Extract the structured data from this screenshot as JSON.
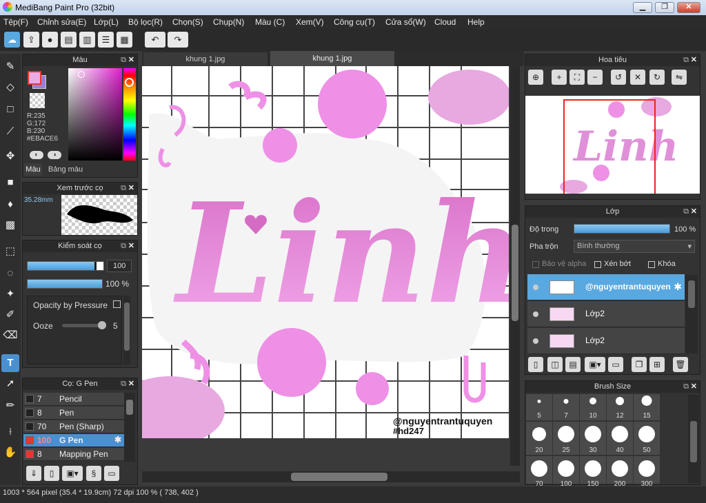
{
  "window": {
    "title": "MediBang Paint Pro (32bit)",
    "minimize": "▁",
    "maximize": "❐",
    "close": "✕"
  },
  "menu": [
    "Tệp(F)",
    "Chỉnh sửa(E)",
    "Lớp(L)",
    "Bộ lọc(R)",
    "Chọn(S)",
    "Chụp(N)",
    "Màu (C)",
    "Xem(V)",
    "Công cụ(T)",
    "Cửa sổ(W)",
    "Cloud",
    "Help"
  ],
  "tabs": [
    "khung 1.jpg",
    "khung 1.jpg"
  ],
  "color_panel": {
    "title": "Màu",
    "r": "R:235",
    "g": "G:172",
    "b": "B:230",
    "hex": "#EBACE6",
    "tab1": "Màu",
    "tab2": "Bảng màu",
    "main_color": "#EBACE6",
    "sub_color": "#9b7fd6"
  },
  "brush_preview": {
    "title": "Xem trước cọ",
    "size": "35.28mm"
  },
  "brush_control": {
    "title": "Kiểm soát cọ",
    "size_value": "100",
    "opacity_value": "100 %",
    "opacity_pressure": "Opacity by Pressure",
    "ooze_label": "Ooze",
    "ooze_value": "5"
  },
  "brush_list": {
    "title": "Cọ: G Pen",
    "items": [
      {
        "size": "7",
        "name": "Pencil",
        "color": "#222"
      },
      {
        "size": "8",
        "name": "Pen",
        "color": "#222"
      },
      {
        "size": "70",
        "name": "Pen (Sharp)",
        "color": "#222"
      },
      {
        "size": "100",
        "name": "G Pen",
        "color": "#e33"
      },
      {
        "size": "8",
        "name": "Mapping Pen",
        "color": "#e33"
      }
    ]
  },
  "navigator": {
    "title": "Hoa tiêu"
  },
  "layers": {
    "title": "Lớp",
    "opacity_label": "Độ trong",
    "opacity_value": "100 %",
    "opacity_level": 1.0,
    "blend_label": "Pha trộn",
    "blend_value": "Bình thường",
    "protect_alpha": "Bảo vệ alpha",
    "clipping": "Xén bớt",
    "lock": "Khóa",
    "items": [
      {
        "name": "@nguyentrantuquyen",
        "selected": true
      },
      {
        "name": "Lớp2",
        "selected": false
      },
      {
        "name": "Lớp2",
        "selected": false
      }
    ]
  },
  "brush_size": {
    "title": "Brush Size",
    "sizes": [
      "5",
      "7",
      "10",
      "12",
      "15",
      "20",
      "25",
      "30",
      "40",
      "50",
      "70",
      "100",
      "150",
      "200",
      "300"
    ]
  },
  "canvas": {
    "main_text": "Linh",
    "watermark1": "@nguyentrantuquyen",
    "watermark2": "#hd247",
    "accent": "#e88ce0"
  },
  "status": {
    "text": "1003 * 564 pixel  (35.4 * 19.9cm)  72 dpi  100 %  ( 738, 402 )"
  }
}
